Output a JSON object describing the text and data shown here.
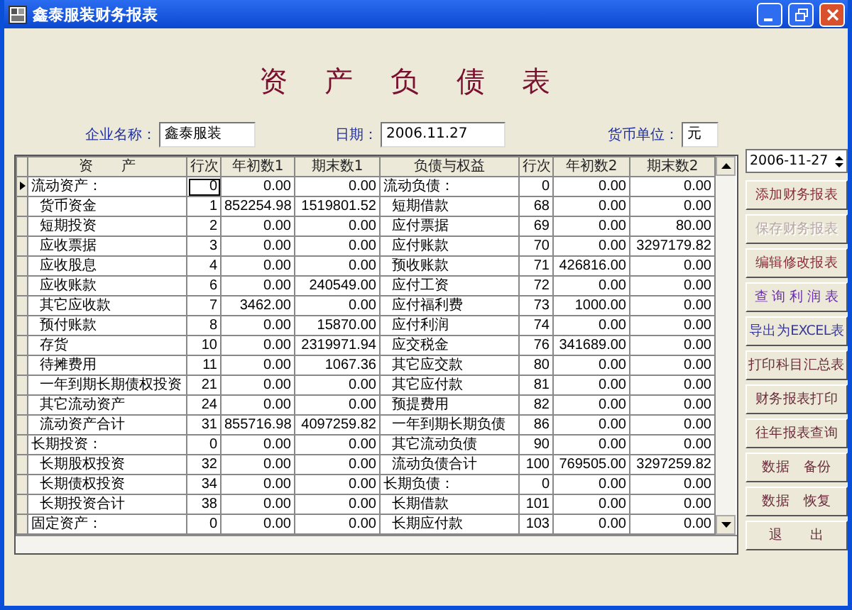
{
  "window": {
    "title": "鑫泰服装财务报表"
  },
  "report_title": "资 产 负 债 表",
  "fields": [
    {
      "label": "企业名称：",
      "value": "鑫泰服装"
    },
    {
      "label": "日期：",
      "value": "2006.11.27"
    },
    {
      "label": "货币单位：",
      "value": "元"
    }
  ],
  "date_picker": {
    "value": "2006-11-27"
  },
  "table": {
    "columns": [
      "资　　产",
      "行次",
      "年初数1",
      "期末数1",
      "负债与权益",
      "行次",
      "年初数2",
      "期末数2"
    ],
    "rows": [
      {
        "current": true,
        "left": {
          "kind": "header",
          "name": "流动资产：",
          "line": "0",
          "begin": "0.00",
          "end": "0.00"
        },
        "right": {
          "kind": "header",
          "name": "流动负债：",
          "line": "0",
          "begin": "0.00",
          "end": "0.00"
        }
      },
      {
        "current": false,
        "left": {
          "kind": "item",
          "name": "货币资金",
          "line": "1",
          "begin": "852254.98",
          "end": "1519801.52"
        },
        "right": {
          "kind": "item",
          "name": "短期借款",
          "line": "68",
          "begin": "0.00",
          "end": "0.00"
        }
      },
      {
        "current": false,
        "left": {
          "kind": "item",
          "name": "短期投资",
          "line": "2",
          "begin": "0.00",
          "end": "0.00"
        },
        "right": {
          "kind": "item",
          "name": "应付票据",
          "line": "69",
          "begin": "0.00",
          "end": "80.00"
        }
      },
      {
        "current": false,
        "left": {
          "kind": "item",
          "name": "应收票据",
          "line": "3",
          "begin": "0.00",
          "end": "0.00"
        },
        "right": {
          "kind": "item",
          "name": "应付账款",
          "line": "70",
          "begin": "0.00",
          "end": "3297179.82"
        }
      },
      {
        "current": false,
        "left": {
          "kind": "item",
          "name": "应收股息",
          "line": "4",
          "begin": "0.00",
          "end": "0.00"
        },
        "right": {
          "kind": "item",
          "name": "预收账款",
          "line": "71",
          "begin": "426816.00",
          "end": "0.00"
        }
      },
      {
        "current": false,
        "left": {
          "kind": "item",
          "name": "应收账款",
          "line": "6",
          "begin": "0.00",
          "end": "240549.00"
        },
        "right": {
          "kind": "item",
          "name": "应付工资",
          "line": "72",
          "begin": "0.00",
          "end": "0.00"
        }
      },
      {
        "current": false,
        "left": {
          "kind": "item",
          "name": "其它应收款",
          "line": "7",
          "begin": "3462.00",
          "end": "0.00"
        },
        "right": {
          "kind": "item",
          "name": "应付福利费",
          "line": "73",
          "begin": "1000.00",
          "end": "0.00"
        }
      },
      {
        "current": false,
        "left": {
          "kind": "item",
          "name": "预付账款",
          "line": "8",
          "begin": "0.00",
          "end": "15870.00"
        },
        "right": {
          "kind": "item",
          "name": "应付利润",
          "line": "74",
          "begin": "0.00",
          "end": "0.00"
        }
      },
      {
        "current": false,
        "left": {
          "kind": "item",
          "name": "存货",
          "line": "10",
          "begin": "0.00",
          "end": "2319971.94"
        },
        "right": {
          "kind": "item",
          "name": "应交税金",
          "line": "76",
          "begin": "341689.00",
          "end": "0.00"
        }
      },
      {
        "current": false,
        "left": {
          "kind": "item",
          "name": "待摊费用",
          "line": "11",
          "begin": "0.00",
          "end": "1067.36"
        },
        "right": {
          "kind": "item",
          "name": "其它应交款",
          "line": "80",
          "begin": "0.00",
          "end": "0.00"
        }
      },
      {
        "current": false,
        "left": {
          "kind": "item",
          "name": "一年到期长期债权投资",
          "line": "21",
          "begin": "0.00",
          "end": "0.00"
        },
        "right": {
          "kind": "item",
          "name": "其它应付款",
          "line": "81",
          "begin": "0.00",
          "end": "0.00"
        }
      },
      {
        "current": false,
        "left": {
          "kind": "item",
          "name": "其它流动资产",
          "line": "24",
          "begin": "0.00",
          "end": "0.00"
        },
        "right": {
          "kind": "item",
          "name": "预提费用",
          "line": "82",
          "begin": "0.00",
          "end": "0.00"
        }
      },
      {
        "current": false,
        "left": {
          "kind": "item",
          "name": "流动资产合计",
          "line": "31",
          "begin": "855716.98",
          "end": "4097259.82"
        },
        "right": {
          "kind": "item",
          "name": "一年到期长期负债",
          "line": "86",
          "begin": "0.00",
          "end": "0.00"
        }
      },
      {
        "current": false,
        "left": {
          "kind": "header",
          "name": "长期投资：",
          "line": "0",
          "begin": "0.00",
          "end": "0.00"
        },
        "right": {
          "kind": "item",
          "name": "其它流动负债",
          "line": "90",
          "begin": "0.00",
          "end": "0.00"
        }
      },
      {
        "current": false,
        "left": {
          "kind": "item",
          "name": "长期股权投资",
          "line": "32",
          "begin": "0.00",
          "end": "0.00"
        },
        "right": {
          "kind": "item",
          "name": "流动负债合计",
          "line": "100",
          "begin": "769505.00",
          "end": "3297259.82"
        }
      },
      {
        "current": false,
        "left": {
          "kind": "item",
          "name": "长期债权投资",
          "line": "34",
          "begin": "0.00",
          "end": "0.00"
        },
        "right": {
          "kind": "header",
          "name": "长期负债：",
          "line": "0",
          "begin": "0.00",
          "end": "0.00"
        }
      },
      {
        "current": false,
        "left": {
          "kind": "item",
          "name": "长期投资合计",
          "line": "38",
          "begin": "0.00",
          "end": "0.00"
        },
        "right": {
          "kind": "item",
          "name": "长期借款",
          "line": "101",
          "begin": "0.00",
          "end": "0.00"
        }
      },
      {
        "current": false,
        "left": {
          "kind": "header",
          "name": "固定资产：",
          "line": "0",
          "begin": "0.00",
          "end": "0.00"
        },
        "right": {
          "kind": "item",
          "name": "长期应付款",
          "line": "103",
          "begin": "0.00",
          "end": "0.00"
        }
      }
    ]
  },
  "buttons": [
    {
      "label": "添加财务报表",
      "disabled": false,
      "color": "#8b2c3c"
    },
    {
      "label": "保存财务报表",
      "disabled": true
    },
    {
      "label": "编辑修改报表",
      "disabled": false,
      "color": "#8b2c3c"
    },
    {
      "label": "查 询 利 润 表",
      "disabled": false,
      "color": "#6a2cb0"
    },
    {
      "label": "导出为EXCEL表",
      "disabled": false,
      "color": "#3a3a9a"
    },
    {
      "label": "打印科目汇总表",
      "disabled": false,
      "color": "#6b2b3b"
    },
    {
      "label": "财务报表打印",
      "disabled": false,
      "color": "#6b2b3b"
    },
    {
      "label": "往年报表查询",
      "disabled": false,
      "color": "#6b2b3b"
    },
    {
      "label": "数据　备份",
      "disabled": false,
      "color": "#6b2b3b"
    },
    {
      "label": "数据　恢复",
      "disabled": false,
      "color": "#6b2b3b"
    },
    {
      "label": "退　　出",
      "disabled": false,
      "color": "#6b2b3b"
    }
  ]
}
